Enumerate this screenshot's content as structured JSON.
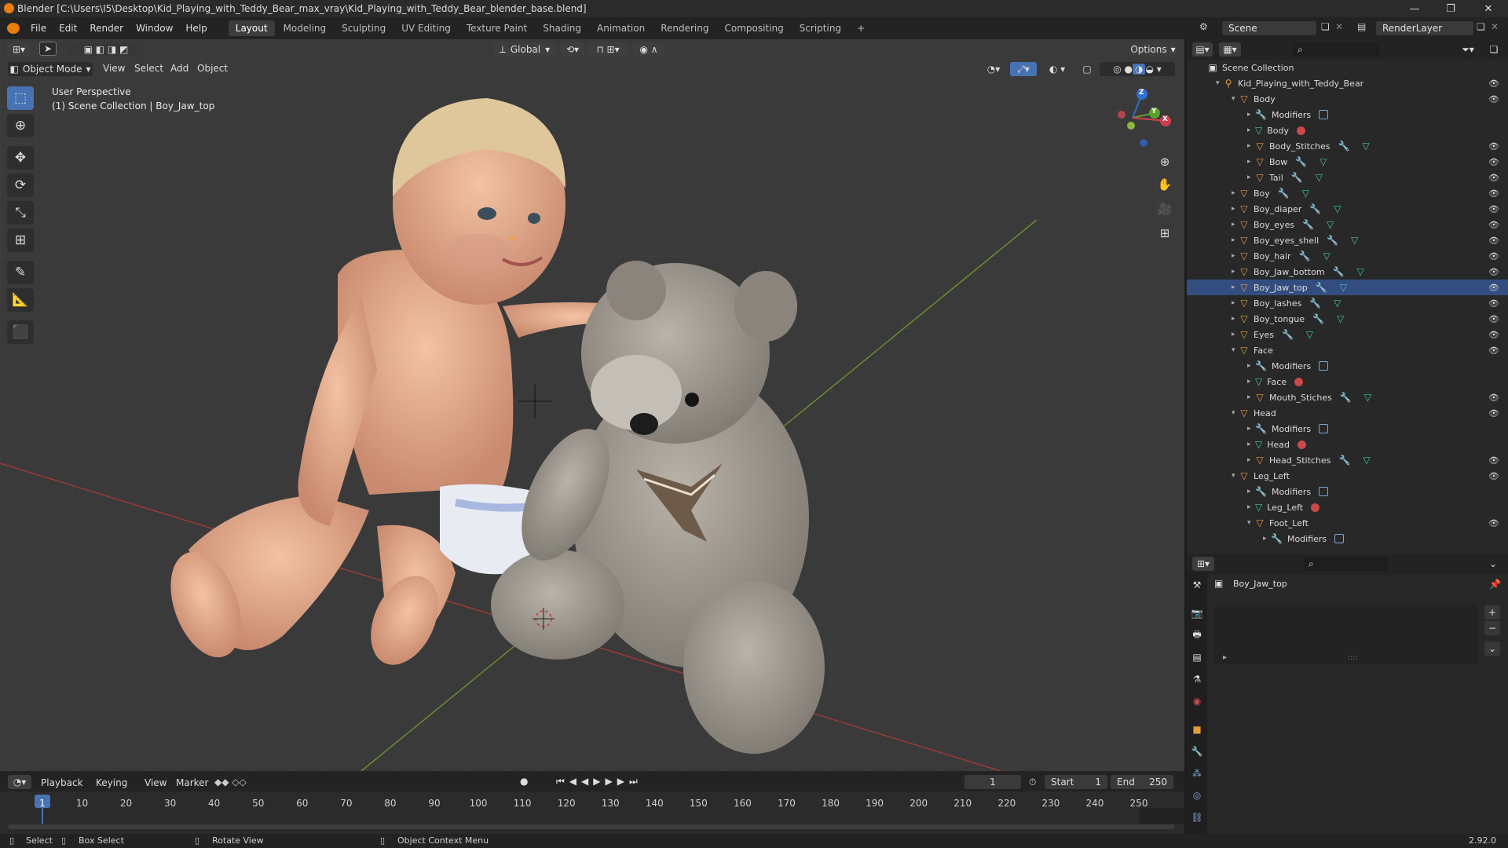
{
  "window": {
    "title": "Blender [C:\\Users\\I5\\Desktop\\Kid_Playing_with_Teddy_Bear_max_vray\\Kid_Playing_with_Teddy_Bear_blender_base.blend]",
    "minimize": "—",
    "maximize": "❐",
    "close": "✕"
  },
  "menu": [
    "File",
    "Edit",
    "Render",
    "Window",
    "Help"
  ],
  "workspaces": [
    "Layout",
    "Modeling",
    "Sculpting",
    "UV Editing",
    "Texture Paint",
    "Shading",
    "Animation",
    "Rendering",
    "Compositing",
    "Scripting"
  ],
  "workspace_add": "+",
  "scene": {
    "name": "Scene",
    "render_layer": "RenderLayer"
  },
  "viewport": {
    "transform_orientation": "Global",
    "options_label": "Options",
    "mode": "Object Mode",
    "menus": [
      "View",
      "Select",
      "Add",
      "Object"
    ],
    "perspective_label": "User Perspective",
    "collection_label": "(1) Scene Collection | Boy_Jaw_top",
    "gizmo_axes": {
      "x": "X",
      "y": "Y",
      "z": "Z"
    }
  },
  "outliner": {
    "search_placeholder": "",
    "rows": [
      {
        "depth": 0,
        "icon": "collection",
        "label": "Scene Collection",
        "expand": "",
        "eye": false,
        "extras": []
      },
      {
        "depth": 1,
        "icon": "scene",
        "label": "Kid_Playing_with_Teddy_Bear",
        "expand": "▾",
        "eye": true,
        "extras": []
      },
      {
        "depth": 2,
        "icon": "object",
        "label": "Body",
        "expand": "▾",
        "eye": true,
        "extras": []
      },
      {
        "depth": 3,
        "icon": "wrench",
        "label": "Modifiers",
        "expand": "▸",
        "eye": false,
        "extras": [
          "mod"
        ]
      },
      {
        "depth": 3,
        "icon": "mesh",
        "label": "Body",
        "expand": "▸",
        "eye": false,
        "extras": [
          "mat"
        ]
      },
      {
        "depth": 3,
        "icon": "object",
        "label": "Body_Stitches",
        "expand": "▸",
        "eye": true,
        "extras": [
          "wr",
          "mesh"
        ]
      },
      {
        "depth": 3,
        "icon": "object",
        "label": "Bow",
        "expand": "▸",
        "eye": true,
        "extras": [
          "wr",
          "mesh"
        ]
      },
      {
        "depth": 3,
        "icon": "object",
        "label": "Tail",
        "expand": "▸",
        "eye": true,
        "extras": [
          "wr",
          "mesh"
        ]
      },
      {
        "depth": 2,
        "icon": "object",
        "label": "Boy",
        "expand": "▸",
        "eye": true,
        "extras": [
          "wr",
          "mesh"
        ]
      },
      {
        "depth": 2,
        "icon": "object",
        "label": "Boy_diaper",
        "expand": "▸",
        "eye": true,
        "extras": [
          "wr",
          "mesh"
        ]
      },
      {
        "depth": 2,
        "icon": "object",
        "label": "Boy_eyes",
        "expand": "▸",
        "eye": true,
        "extras": [
          "wr",
          "mesh"
        ]
      },
      {
        "depth": 2,
        "icon": "object",
        "label": "Boy_eyes_shell",
        "expand": "▸",
        "eye": true,
        "extras": [
          "wr",
          "mesh"
        ]
      },
      {
        "depth": 2,
        "icon": "object",
        "label": "Boy_hair",
        "expand": "▸",
        "eye": true,
        "extras": [
          "wr",
          "mesh"
        ]
      },
      {
        "depth": 2,
        "icon": "object",
        "label": "Boy_Jaw_bottom",
        "expand": "▸",
        "eye": true,
        "extras": [
          "wr",
          "mesh"
        ]
      },
      {
        "depth": 2,
        "icon": "object",
        "label": "Boy_Jaw_top",
        "expand": "▸",
        "eye": true,
        "extras": [
          "wr",
          "mesh"
        ],
        "selected": true
      },
      {
        "depth": 2,
        "icon": "object",
        "label": "Boy_lashes",
        "expand": "▸",
        "eye": true,
        "extras": [
          "wr",
          "mesh"
        ]
      },
      {
        "depth": 2,
        "icon": "object",
        "label": "Boy_tongue",
        "expand": "▸",
        "eye": true,
        "extras": [
          "wr",
          "mesh"
        ]
      },
      {
        "depth": 2,
        "icon": "object",
        "label": "Eyes",
        "expand": "▸",
        "eye": true,
        "extras": [
          "wr",
          "mesh"
        ]
      },
      {
        "depth": 2,
        "icon": "object",
        "label": "Face",
        "expand": "▾",
        "eye": true,
        "extras": []
      },
      {
        "depth": 3,
        "icon": "wrench",
        "label": "Modifiers",
        "expand": "▸",
        "eye": false,
        "extras": [
          "mod"
        ]
      },
      {
        "depth": 3,
        "icon": "mesh",
        "label": "Face",
        "expand": "▸",
        "eye": false,
        "extras": [
          "mat"
        ]
      },
      {
        "depth": 3,
        "icon": "object",
        "label": "Mouth_Stiches",
        "expand": "▸",
        "eye": true,
        "extras": [
          "wr",
          "mesh"
        ]
      },
      {
        "depth": 2,
        "icon": "object",
        "label": "Head",
        "expand": "▾",
        "eye": true,
        "extras": []
      },
      {
        "depth": 3,
        "icon": "wrench",
        "label": "Modifiers",
        "expand": "▸",
        "eye": false,
        "extras": [
          "mod"
        ]
      },
      {
        "depth": 3,
        "icon": "mesh",
        "label": "Head",
        "expand": "▸",
        "eye": false,
        "extras": [
          "mat"
        ]
      },
      {
        "depth": 3,
        "icon": "object",
        "label": "Head_Stitches",
        "expand": "▸",
        "eye": true,
        "extras": [
          "wr",
          "mesh"
        ]
      },
      {
        "depth": 2,
        "icon": "object",
        "label": "Leg_Left",
        "expand": "▾",
        "eye": true,
        "extras": []
      },
      {
        "depth": 3,
        "icon": "wrench",
        "label": "Modifiers",
        "expand": "▸",
        "eye": false,
        "extras": [
          "mod"
        ]
      },
      {
        "depth": 3,
        "icon": "mesh",
        "label": "Leg_Left",
        "expand": "▸",
        "eye": false,
        "extras": [
          "mat"
        ]
      },
      {
        "depth": 3,
        "icon": "object",
        "label": "Foot_Left",
        "expand": "▾",
        "eye": true,
        "extras": []
      },
      {
        "depth": 4,
        "icon": "wrench",
        "label": "Modifiers",
        "expand": "▸",
        "eye": false,
        "extras": [
          "mod"
        ]
      }
    ]
  },
  "properties": {
    "object_name": "Boy_Jaw_top",
    "list_add": "+",
    "list_remove": "−",
    "list_more": "⌄",
    "list_grip": "::::",
    "list_expand": "▸"
  },
  "timeline": {
    "menus": [
      "Playback",
      "Keying",
      "View",
      "Marker"
    ],
    "current_frame": "1",
    "start_label": "Start",
    "start": "1",
    "end_label": "End",
    "end": "250",
    "ticks": [
      "1",
      "10",
      "20",
      "30",
      "40",
      "50",
      "60",
      "70",
      "80",
      "90",
      "100",
      "110",
      "120",
      "130",
      "140",
      "150",
      "160",
      "170",
      "180",
      "190",
      "200",
      "210",
      "220",
      "230",
      "240",
      "250"
    ]
  },
  "statusbar": {
    "select": "Select",
    "box_select": "Box Select",
    "rotate_view": "Rotate View",
    "context_menu": "Object Context Menu",
    "version": "2.92.0"
  }
}
